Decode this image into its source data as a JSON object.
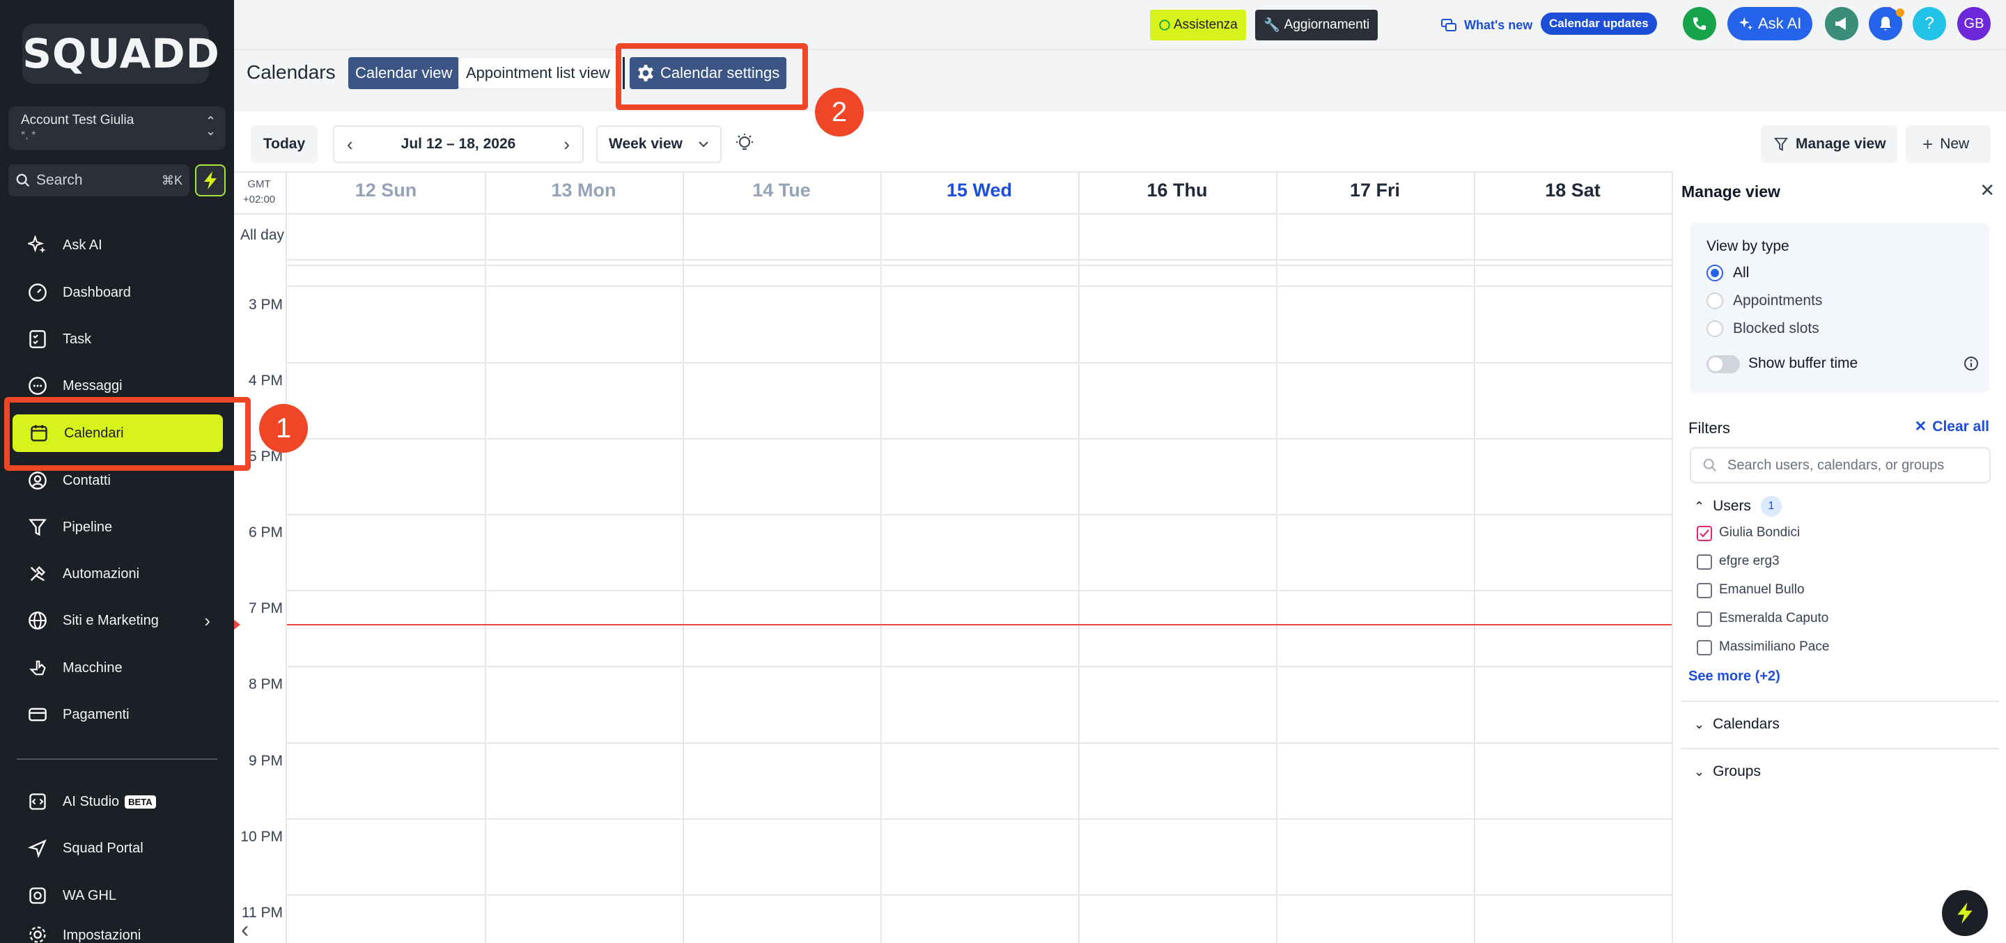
{
  "sidebar": {
    "logo": "SQUADD",
    "account": {
      "name": "Account Test Giulia",
      "sub": "*, *"
    },
    "search": {
      "label": "Search",
      "shortcut": "⌘K"
    },
    "items": [
      {
        "label": "Ask AI",
        "icon": "sparkle-icon"
      },
      {
        "label": "Dashboard",
        "icon": "gauge-icon"
      },
      {
        "label": "Task",
        "icon": "checklist-icon"
      },
      {
        "label": "Messaggi",
        "icon": "chat-icon"
      },
      {
        "label": "Calendari",
        "icon": "calendar-icon"
      },
      {
        "label": "Contatti",
        "icon": "contact-icon"
      },
      {
        "label": "Pipeline",
        "icon": "filter-icon"
      },
      {
        "label": "Automazioni",
        "icon": "tools-icon"
      },
      {
        "label": "Siti e Marketing",
        "icon": "globe-icon"
      },
      {
        "label": "Macchine",
        "icon": "hand-icon"
      },
      {
        "label": "Pagamenti",
        "icon": "card-icon"
      }
    ],
    "bottom_items": [
      {
        "label": "AI Studio",
        "badge": "BETA"
      },
      {
        "label": "Squad Portal"
      },
      {
        "label": "WA GHL"
      },
      {
        "label": "Impostazioni"
      }
    ]
  },
  "topbar": {
    "assistenza": "Assistenza",
    "aggiornamenti": "Aggiornamenti",
    "whats_new": "What's new",
    "calendar_updates": "Calendar updates",
    "ask_ai": "Ask AI",
    "help": "?",
    "avatar": "GB"
  },
  "header": {
    "title": "Calendars",
    "tabs": [
      "Calendar view",
      "Appointment list view",
      "Calendar settings"
    ]
  },
  "toolbar": {
    "today": "Today",
    "range": "Jul 12 – 18, 2026",
    "view": "Week view",
    "manage_view": "Manage view",
    "new": "New"
  },
  "calendar": {
    "tz": [
      "GMT",
      "+02:00"
    ],
    "all_day": "All day",
    "days": [
      "12 Sun",
      "13 Mon",
      "14 Tue",
      "15 Wed",
      "16 Thu",
      "17 Fri",
      "18 Sat"
    ],
    "hours": [
      "3 PM",
      "4 PM",
      "5 PM",
      "6 PM",
      "7 PM",
      "8 PM",
      "9 PM",
      "10 PM",
      "11 PM"
    ]
  },
  "panel": {
    "title": "Manage view",
    "view_by_type": "View by type",
    "types": [
      "All",
      "Appointments",
      "Blocked slots"
    ],
    "selected_type": "All",
    "buffer": "Show buffer time",
    "filters": "Filters",
    "clear_all": "Clear all",
    "search_placeholder": "Search users, calendars, or groups",
    "users_label": "Users",
    "users_count": "1",
    "users": [
      {
        "name": "Giulia Bondici",
        "checked": true
      },
      {
        "name": "efgre erg3",
        "checked": false
      },
      {
        "name": "Emanuel Bullo",
        "checked": false
      },
      {
        "name": "Esmeralda Caputo",
        "checked": false
      },
      {
        "name": "Massimiliano Pace",
        "checked": false
      }
    ],
    "see_more": "See more (+2)",
    "calendars": "Calendars",
    "groups": "Groups"
  },
  "annotations": [
    "1",
    "2"
  ],
  "colors": {
    "accent_lime": "#d8f21b",
    "annotation_red": "#ef4627",
    "primary_blue": "#1d4ed8",
    "sidebar_bg": "#1c1f26"
  }
}
